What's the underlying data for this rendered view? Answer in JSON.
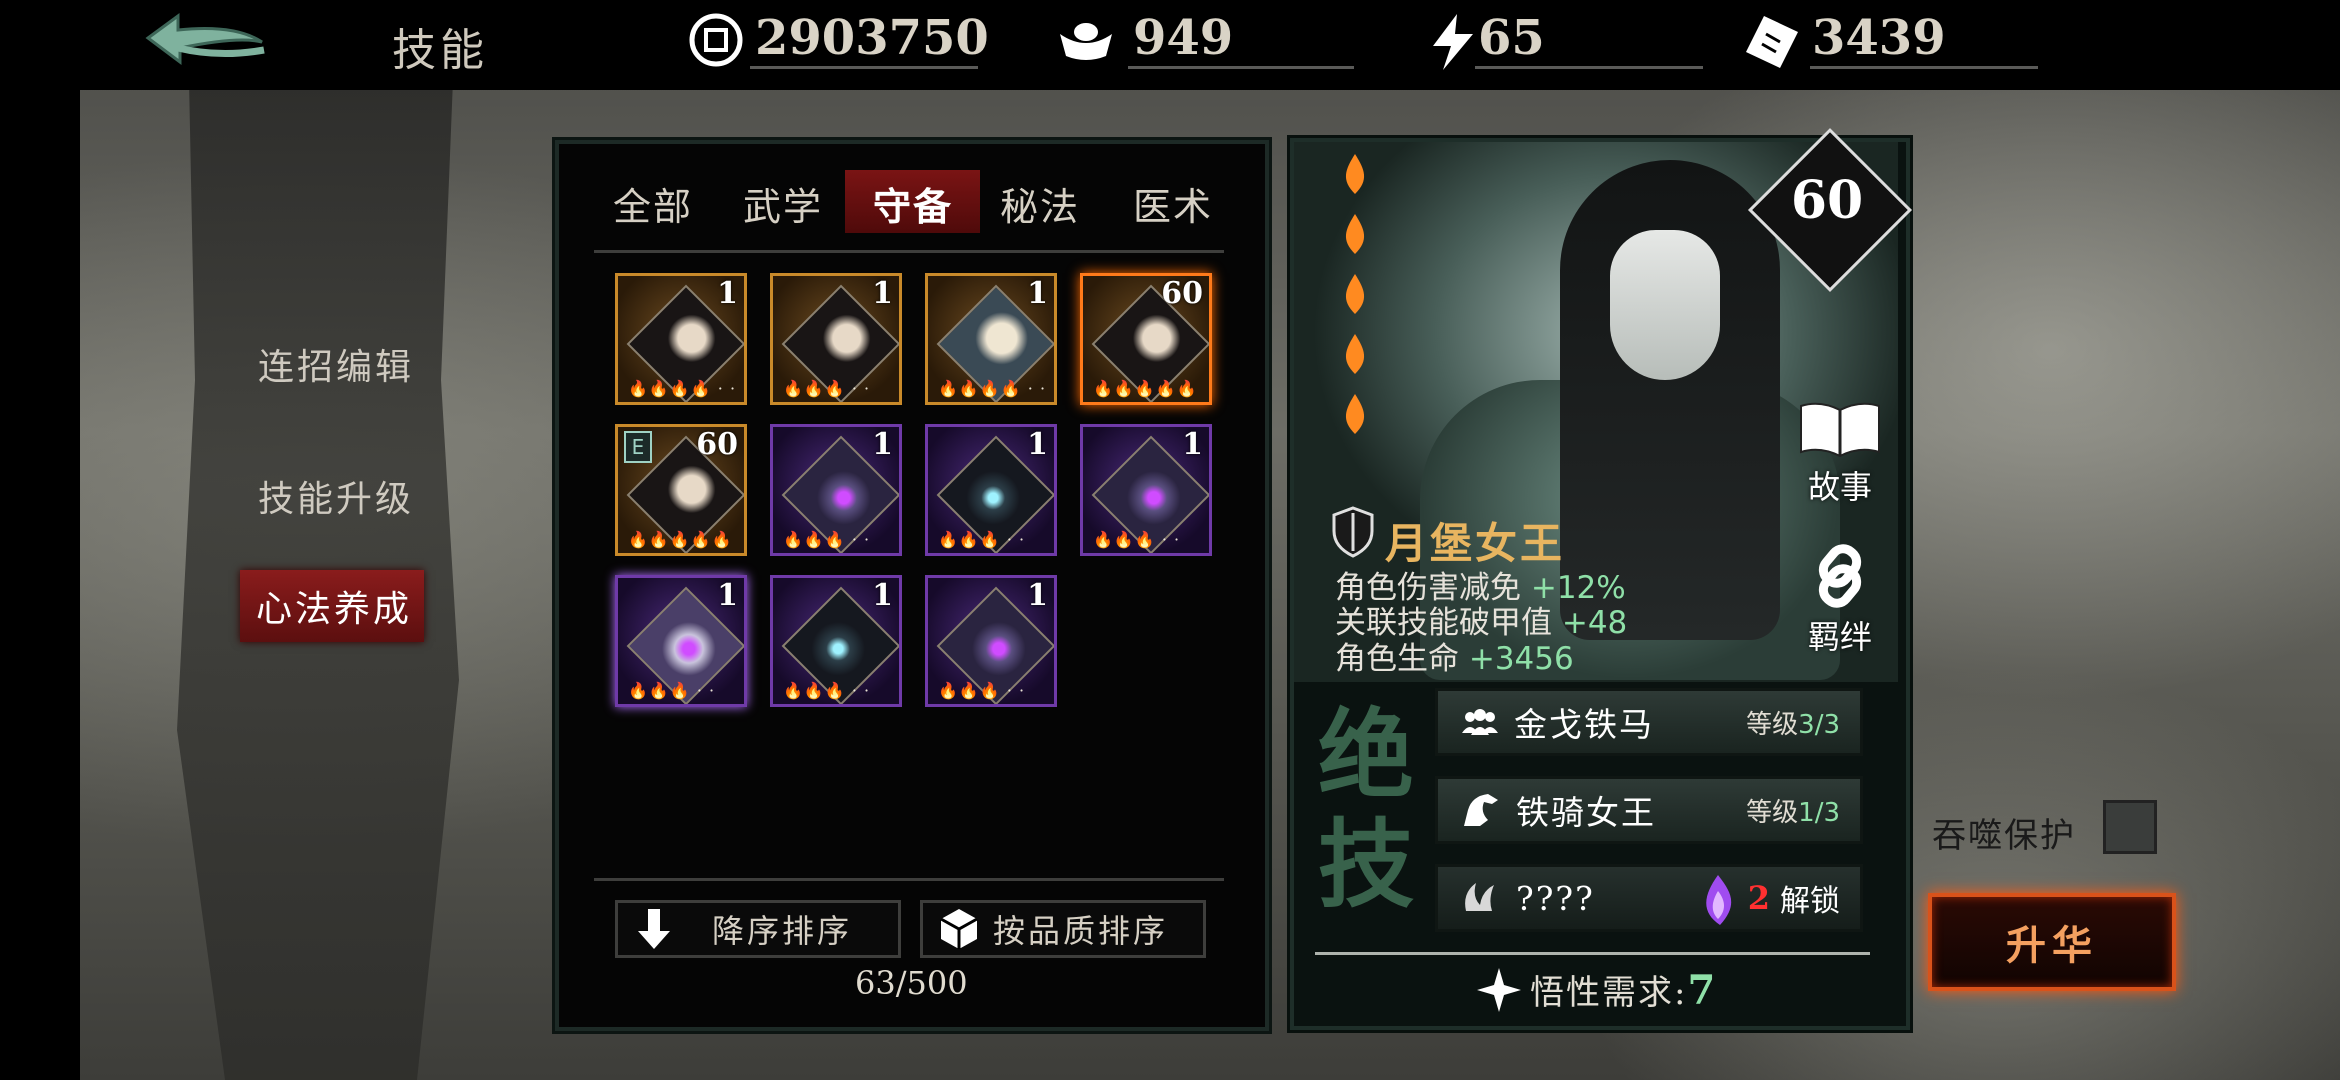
{
  "header": {
    "title": "技能",
    "resources": [
      {
        "icon": "coin-icon",
        "value": "2903750"
      },
      {
        "icon": "silver-ingot-icon",
        "value": "949"
      },
      {
        "icon": "lightning-icon",
        "value": "65"
      },
      {
        "icon": "ticket-icon",
        "value": "3439"
      }
    ]
  },
  "menu": {
    "items": [
      {
        "label": "连招编辑"
      },
      {
        "label": "技能升级"
      },
      {
        "label": "心法养成",
        "active": true
      }
    ]
  },
  "skills_panel": {
    "tabs": [
      {
        "label": "全部"
      },
      {
        "label": "武学"
      },
      {
        "label": "守备",
        "active": true
      },
      {
        "label": "秘法"
      },
      {
        "label": "医术"
      }
    ],
    "cards": [
      {
        "icon": "dark-haired-woman-portrait-icon",
        "level": "1",
        "rarity": "gold",
        "flames": "🔥🔥🔥🔥 · ·"
      },
      {
        "icon": "dark-haired-woman-portrait-icon",
        "level": "1",
        "rarity": "gold",
        "flames": "🔥🔥🔥 · ·"
      },
      {
        "icon": "silver-haired-woman-portrait-icon",
        "level": "1",
        "rarity": "gold",
        "flames": "🔥🔥🔥🔥 · ·"
      },
      {
        "icon": "dark-haired-woman-portrait-icon",
        "level": "60",
        "rarity": "gold-selected",
        "flames": "🔥🔥🔥🔥🔥"
      },
      {
        "icon": "dark-haired-woman-portrait-icon",
        "level": "60",
        "rarity": "gold",
        "flames": "🔥🔥🔥🔥🔥",
        "equipped_badge": "E"
      },
      {
        "icon": "armored-knight-icon",
        "level": "1",
        "rarity": "purple",
        "flames": "🔥🔥🔥 · ·"
      },
      {
        "icon": "hooded-mask-icon",
        "level": "1",
        "rarity": "purple",
        "flames": "🔥🔥🔥 · ·"
      },
      {
        "icon": "armored-knight-icon",
        "level": "1",
        "rarity": "purple",
        "flames": "🔥🔥🔥 · ·"
      },
      {
        "icon": "armored-knight-icon",
        "level": "1",
        "rarity": "purple",
        "flames": "🔥🔥🔥 · ·"
      },
      {
        "icon": "hooded-mask-icon",
        "level": "1",
        "rarity": "purple",
        "flames": "🔥🔥🔥 · ·"
      },
      {
        "icon": "armored-knight-icon",
        "level": "1",
        "rarity": "purple",
        "flames": "🔥🔥🔥 · ·"
      }
    ],
    "sort_desc_label": "降序排序",
    "sort_quality_label": "按品质排序",
    "count": "63/500"
  },
  "detail": {
    "level": "60",
    "name": "月堡女王",
    "stats": [
      {
        "label": "角色伤害减免",
        "value": "+12%"
      },
      {
        "label": "关联技能破甲值",
        "value": "+48"
      },
      {
        "label": "角色生命",
        "value": "+3456"
      }
    ],
    "story_label": "故事",
    "bond_label": "羁绊",
    "section_title": "绝技",
    "abilities": [
      {
        "name": "金戈铁马",
        "level_prefix": "等级",
        "level": "3/3",
        "icon": "group-icon"
      },
      {
        "name": "铁骑女王",
        "level_prefix": "等级",
        "level": "1/3",
        "icon": "horse-icon"
      },
      {
        "name": "????",
        "unlock_count": "2",
        "unlock_label": "解锁",
        "icon": "claw-icon"
      }
    ],
    "requirement_label": "悟性需求:",
    "requirement_value": "7"
  },
  "actions": {
    "swallow_protect_label": "吞噬保护",
    "ascend_label": "升华"
  },
  "colors": {
    "accent_red": "#7a1414",
    "stat_green": "#8fe0a8",
    "name_gold": "#e8b560",
    "ascend_border": "#d9521a"
  }
}
